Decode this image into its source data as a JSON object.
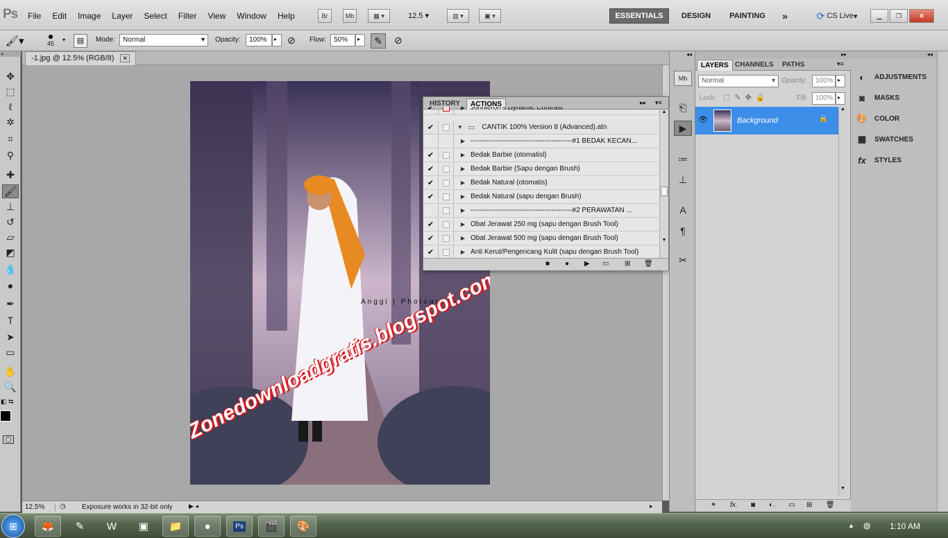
{
  "app": {
    "logo": "Ps"
  },
  "menu": [
    "File",
    "Edit",
    "Image",
    "Layer",
    "Select",
    "Filter",
    "View",
    "Window",
    "Help"
  ],
  "appbar": {
    "bridge": "Br",
    "mini_bridge": "Mb",
    "zoom": "12.5"
  },
  "workspaces": {
    "essentials": "ESSENTIALS",
    "design": "DESIGN",
    "painting": "PAINTING",
    "more": "»",
    "cs_live": "CS Live"
  },
  "options": {
    "brush_size": "45",
    "mode_label": "Mode:",
    "mode_value": "Normal",
    "opacity_label": "Opacity:",
    "opacity_value": "100%",
    "flow_label": "Flow:",
    "flow_value": "50%"
  },
  "document": {
    "tab_title": "-1.jpg @ 12.5% (RGB/8)"
  },
  "photo": {
    "caption": "Anggi | Photography",
    "watermark": "Zonedownloadgratis.blogspot.com"
  },
  "status": {
    "zoom": "12.5%",
    "message": "Exposure works in 32-bit only"
  },
  "actions_panel": {
    "tabs": {
      "history": "HISTORY",
      "actions": "ACTIONS"
    },
    "rows": [
      {
        "checked": true,
        "dialog": "red",
        "expander": "right",
        "indent": 1,
        "text": "Johnleron's Dynamic Contrast"
      },
      {
        "checked": true,
        "dialog": "box",
        "expander": "down",
        "indent": 0,
        "folder": true,
        "text": "CANTIK 100% Version 8 (Advanced).atn"
      },
      {
        "checked": false,
        "dialog": "none",
        "expander": "right",
        "indent": 1,
        "text": "--------------------------------------------#1 BEDAK KECAN..."
      },
      {
        "checked": true,
        "dialog": "box",
        "expander": "right",
        "indent": 1,
        "text": "Bedak Barbie  (otomatisl)"
      },
      {
        "checked": true,
        "dialog": "box",
        "expander": "right",
        "indent": 1,
        "text": "Bedak Barbie  (Sapu dengan Brush)"
      },
      {
        "checked": true,
        "dialog": "box",
        "expander": "right",
        "indent": 1,
        "text": "Bedak Natural (otomatis)"
      },
      {
        "checked": true,
        "dialog": "box",
        "expander": "right",
        "indent": 1,
        "text": "Bedak Natural (sapu dengan Brush)"
      },
      {
        "checked": false,
        "dialog": "box",
        "expander": "right",
        "indent": 1,
        "text": "--------------------------------------------#2 PERAWATAN ..."
      },
      {
        "checked": true,
        "dialog": "box",
        "expander": "right",
        "indent": 1,
        "text": "Obat Jerawat 250 mg (sapu dengan Brush Tool)"
      },
      {
        "checked": true,
        "dialog": "box",
        "expander": "right",
        "indent": 1,
        "text": "Obat Jerawat 500 mg (sapu dengan Brush Tool)"
      },
      {
        "checked": true,
        "dialog": "box",
        "expander": "right",
        "indent": 1,
        "text": "Anti Kerut/Pengencang Kulit (sapu dengan Brush Tool)"
      }
    ]
  },
  "layers_panel": {
    "tabs": {
      "layers": "LAYERS",
      "channels": "CHANNELS",
      "paths": "PATHS"
    },
    "blend": "Normal",
    "opacity_label": "Opacity:",
    "opacity_value": "100%",
    "lock_label": "Lock:",
    "fill_label": "Fill:",
    "fill_value": "100%",
    "layer_name": "Background"
  },
  "right_dock": [
    "ADJUSTMENTS",
    "MASKS",
    "COLOR",
    "SWATCHES",
    "STYLES"
  ],
  "taskbar": {
    "time": "1:10 AM"
  },
  "colors": {
    "selection": "#3d8ee8",
    "accent_essentials": "#6a6a6a"
  }
}
